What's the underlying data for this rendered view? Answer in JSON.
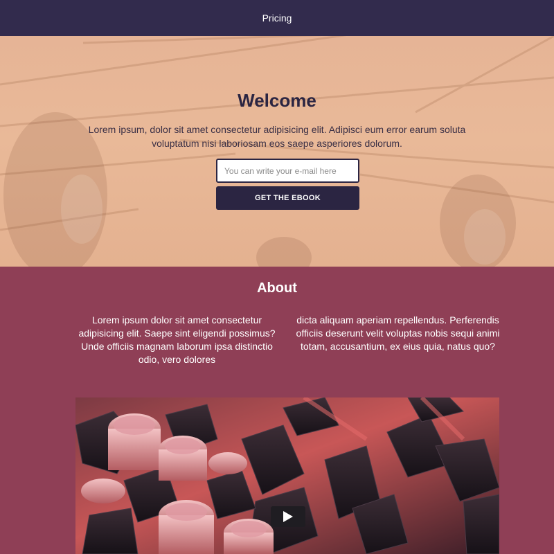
{
  "nav": {
    "link": "Pricing"
  },
  "hero": {
    "title": "Welcome",
    "text": "Lorem ipsum, dolor sit amet consectetur adipisicing elit. Adipisci eum error earum soluta voluptatum nisi laboriosam eos saepe asperiores dolorum.",
    "email_placeholder": "You can write your e-mail here",
    "email_value": "",
    "cta_label": "GET THE EBOOK"
  },
  "about": {
    "title": "About",
    "col1": "Lorem ipsum dolor sit amet consectetur adipisicing elit. Saepe sint eligendi possimus? Unde officiis magnam laborum ipsa distinctio odio, vero dolores",
    "col2": "dicta aliquam aperiam repellendus. Perferendis officiis deserunt velit voluptas nobis sequi animi totam, accusantium, ex eius quia, natus quo?"
  },
  "video": {
    "play_icon": "play-icon"
  },
  "colors": {
    "nav_bg": "#322b4d",
    "hero_bg": "#e7b696",
    "about_bg": "#8f3f56",
    "button_bg": "#2b2542",
    "text_dark": "#2b2542"
  }
}
